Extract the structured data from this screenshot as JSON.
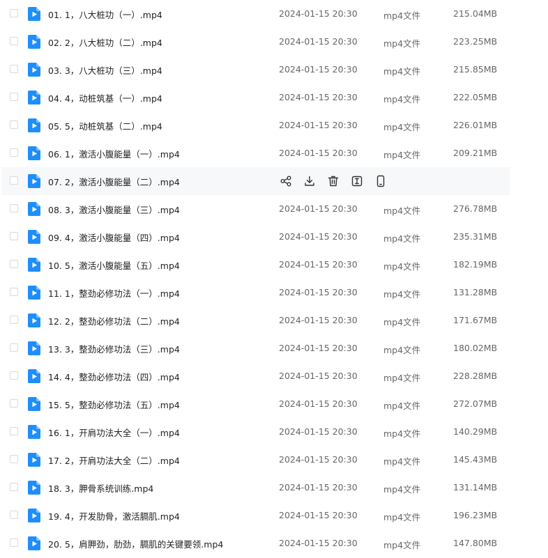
{
  "files": [
    {
      "name": "01. 1，八大桩功（一）.mp4",
      "date": "2024-01-15 20:30",
      "type": "mp4文件",
      "size": "215.04MB"
    },
    {
      "name": "02. 2，八大桩功（二）.mp4",
      "date": "2024-01-15 20:30",
      "type": "mp4文件",
      "size": "223.25MB"
    },
    {
      "name": "03. 3，八大桩功（三）.mp4",
      "date": "2024-01-15 20:30",
      "type": "mp4文件",
      "size": "215.85MB"
    },
    {
      "name": "04. 4，动桩筑基（一）.mp4",
      "date": "2024-01-15 20:30",
      "type": "mp4文件",
      "size": "222.05MB"
    },
    {
      "name": "05. 5，动桩筑基（二）.mp4",
      "date": "2024-01-15 20:30",
      "type": "mp4文件",
      "size": "226.01MB"
    },
    {
      "name": "06. 1，激活小腹能量（一）.mp4",
      "date": "2024-01-15 20:30",
      "type": "mp4文件",
      "size": "209.21MB"
    },
    {
      "name": "07. 2，激活小腹能量（二）.mp4",
      "hovered": true
    },
    {
      "name": "08. 3，激活小腹能量（三）.mp4",
      "date": "2024-01-15 20:30",
      "type": "mp4文件",
      "size": "276.78MB"
    },
    {
      "name": "09. 4，激活小腹能量（四）.mp4",
      "date": "2024-01-15 20:30",
      "type": "mp4文件",
      "size": "235.31MB"
    },
    {
      "name": "10. 5，激活小腹能量（五）.mp4",
      "date": "2024-01-15 20:30",
      "type": "mp4文件",
      "size": "182.19MB"
    },
    {
      "name": "11. 1，整劲必修功法（一）.mp4",
      "date": "2024-01-15 20:30",
      "type": "mp4文件",
      "size": "131.28MB"
    },
    {
      "name": "12. 2，整劲必修功法（二）.mp4",
      "date": "2024-01-15 20:30",
      "type": "mp4文件",
      "size": "171.67MB"
    },
    {
      "name": "13. 3，整劲必修功法（三）.mp4",
      "date": "2024-01-15 20:30",
      "type": "mp4文件",
      "size": "180.02MB"
    },
    {
      "name": "14. 4，整劲必修功法（四）.mp4",
      "date": "2024-01-15 20:30",
      "type": "mp4文件",
      "size": "228.28MB"
    },
    {
      "name": "15. 5，整劲必修功法（五）.mp4",
      "date": "2024-01-15 20:30",
      "type": "mp4文件",
      "size": "272.07MB"
    },
    {
      "name": "16. 1，开肩功法大全（一）.mp4",
      "date": "2024-01-15 20:30",
      "type": "mp4文件",
      "size": "140.29MB"
    },
    {
      "name": "17. 2，开肩功法大全（二）.mp4",
      "date": "2024-01-15 20:30",
      "type": "mp4文件",
      "size": "145.43MB"
    },
    {
      "name": "18. 3，胛骨系统训练.mp4",
      "date": "2024-01-15 20:30",
      "type": "mp4文件",
      "size": "131.14MB"
    },
    {
      "name": "19. 4，开发肋骨，激活膈肌.mp4",
      "date": "2024-01-15 20:30",
      "type": "mp4文件",
      "size": "196.23MB"
    },
    {
      "name": "20. 5，肩胛劲，肋劲，膈肌的关键要领.mp4",
      "date": "2024-01-15 20:30",
      "type": "mp4文件",
      "size": "147.80MB"
    }
  ],
  "row_actions": [
    "share-icon",
    "download-icon",
    "delete-icon",
    "rename-icon",
    "mobile-icon"
  ],
  "colors": {
    "file_icon": "#1e8efc",
    "hover_bg": "#f7f8fa",
    "action_icon": "#333333"
  }
}
